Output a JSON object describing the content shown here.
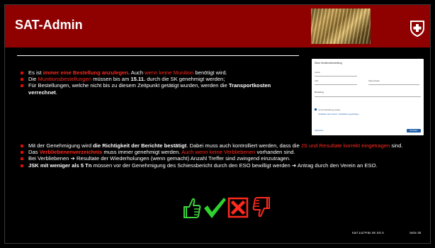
{
  "slide": {
    "title": "SAT-Admin",
    "icons": [
      "thumbs-up-icon",
      "checkmark-icon",
      "cross-box-icon",
      "thumbs-down-icon"
    ],
    "colors": {
      "header": "#8f0000",
      "accent_red": "#ff2a1e",
      "bullet": "#d10f0f",
      "check_green": "#2fd12f"
    }
  },
  "bullets_top": [
    {
      "segments": [
        {
          "t": "Es ist "
        },
        {
          "t": "immer eine Bestellung anzulegen",
          "s": "red-bold"
        },
        {
          "t": ". Auch "
        },
        {
          "t": "wenn keine Munition",
          "s": "red"
        },
        {
          "t": " benötigt wird."
        }
      ]
    },
    {
      "segments": [
        {
          "t": "Die "
        },
        {
          "t": "Munitionsbestellungen",
          "s": "red"
        },
        {
          "t": " müssen bis am "
        },
        {
          "t": "15.11.",
          "s": "bold"
        },
        {
          "t": " durch die SK genehmigt werden;"
        }
      ]
    },
    {
      "segments": [
        {
          "t": "Für Bestellungen, welche nicht bis zu diesem Zeitpunkt getätigt wurden, werden die "
        },
        {
          "t": "Transportkosten verrechnet",
          "s": "bold"
        },
        {
          "t": "."
        }
      ]
    }
  ],
  "bullets_bottom": [
    {
      "segments": [
        {
          "t": "Mit der Genehmigung wird "
        },
        {
          "t": "die Richtigkeit der Berichte bestätigt",
          "s": "bold"
        },
        {
          "t": ". Dabei muss auch kontrolliert werden, dass die "
        },
        {
          "t": "JS und Resultate korrekt eingetragen",
          "s": "red"
        },
        {
          "t": " sind."
        }
      ]
    },
    {
      "segments": [
        {
          "t": "Das "
        },
        {
          "t": "Verbliebenenverzeichnis",
          "s": "red-bold"
        },
        {
          "t": " muss immer genehmigt werden. "
        },
        {
          "t": "Auch wenn keine Verbliebenen",
          "s": "red"
        },
        {
          "t": " vorhanden sind."
        }
      ]
    },
    {
      "segments": [
        {
          "t": "Bei Verbliebenen ➔ Resultate der Wiederholungen (wenn gemacht) Anzahl Treffer sind zwingend einzutragen."
        }
      ]
    },
    {
      "segments": [
        {
          "t": "JSK mit weniger als 5 Tn",
          "s": "bold"
        },
        {
          "t": " müssen vor der Genehmigung des Schiessbericht durch den ESO bewilligt werden ➔ Antrag durch den Verein an ESO."
        }
      ]
    }
  ],
  "modal": {
    "title": "Neue Munitionsbestellung",
    "fields": [
      {
        "label": "Verein"
      },
      {
        "label": "Jahr"
      },
      {
        "label": "Kalenderjahr"
      }
    ],
    "section": "Bestellung",
    "checkbox_label": "Ich bin Bestellung erfasst",
    "link_label": "Verbleiben ohne Verein / Verbleibens genehmigen",
    "left_link": "Abbrechen",
    "button_label": "Bestellen"
  },
  "footer": {
    "author": "Karl Jud Präs SK SG 5",
    "page": "Seite 38"
  }
}
